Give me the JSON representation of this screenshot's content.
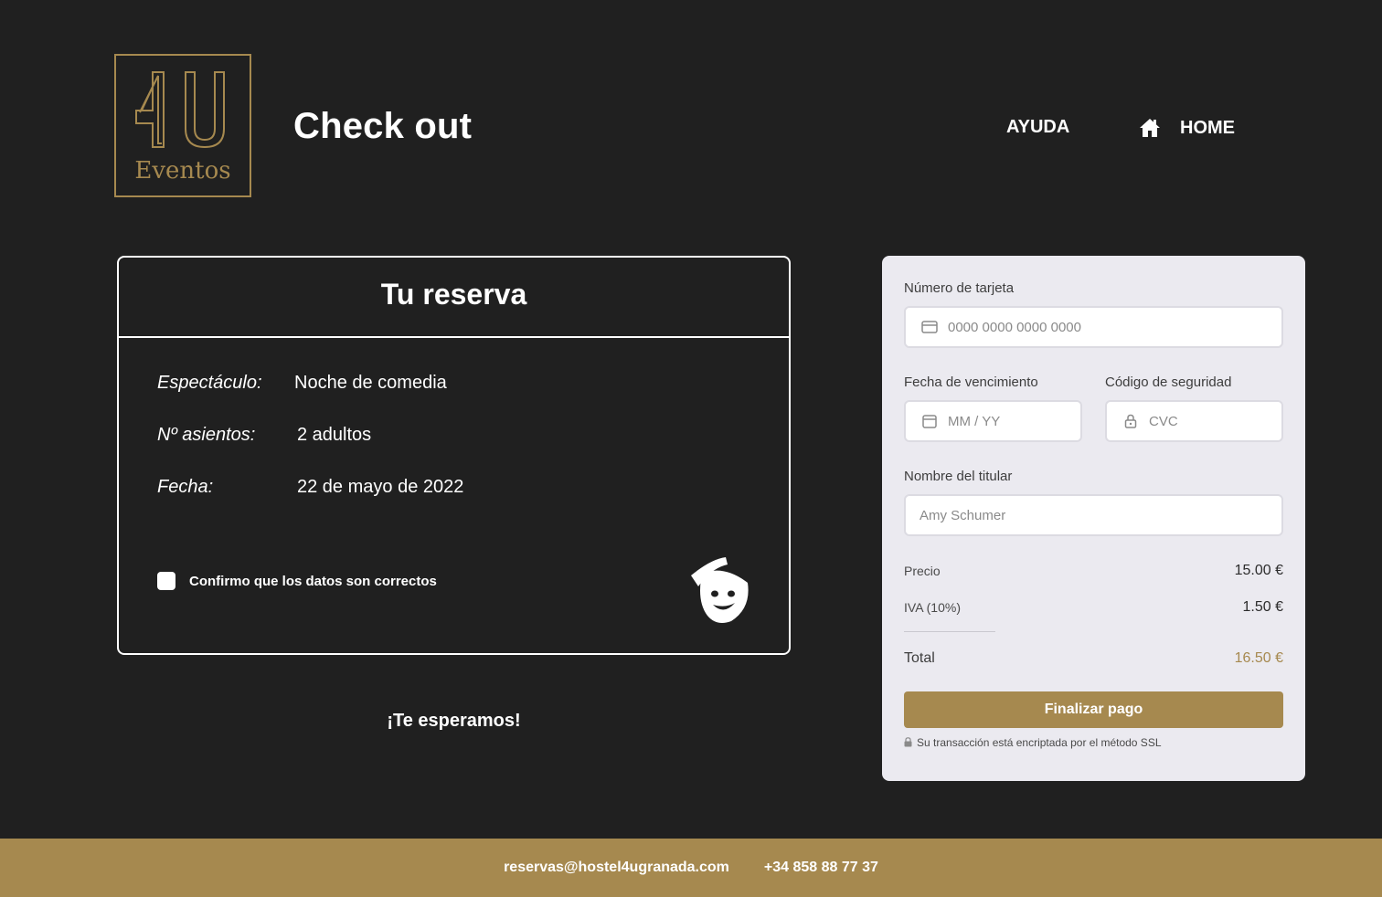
{
  "brand": {
    "logo_text": "4U",
    "logo_subtext": "Eventos",
    "accent_color": "#a6894f",
    "background_color": "#202020"
  },
  "header": {
    "title": "Check out",
    "nav": {
      "help_label": "AYUDA",
      "home_label": "HOME",
      "home_icon": "home-icon"
    }
  },
  "reservation": {
    "title": "Tu reserva",
    "rows": [
      {
        "label": "Espectáculo:",
        "value": "Noche de comedia"
      },
      {
        "label": "Nº asientos:",
        "value": "2 adultos"
      },
      {
        "label": "Fecha:",
        "value": "22 de mayo de 2022"
      }
    ],
    "confirm_label": "Confirmo que los datos son correctos",
    "confirm_checked": false,
    "decor_icon": "theater-mask-icon"
  },
  "welcome_text": "¡Te esperamos!",
  "payment": {
    "card_number": {
      "label": "Número de tarjeta",
      "placeholder": "0000 0000 0000 0000",
      "icon": "credit-card-icon"
    },
    "expiry": {
      "label": "Fecha de vencimiento",
      "placeholder": "MM / YY",
      "icon": "calendar-icon"
    },
    "cvc": {
      "label": "Código de seguridad",
      "placeholder": "CVC",
      "icon": "lock-icon"
    },
    "holder": {
      "label": "Nombre del titular",
      "placeholder": "Amy Schumer"
    },
    "summary": {
      "price_label": "Precio",
      "price_value": "15.00 €",
      "tax_label": "IVA (10%)",
      "tax_value": "1.50 €",
      "total_label": "Total",
      "total_value": "16.50 €"
    },
    "submit_label": "Finalizar pago",
    "ssl_note": "Su transacción está encriptada por el método SSL"
  },
  "footer": {
    "email": "reservas@hostel4ugranada.com",
    "phone": "+34 858 88 77 37"
  }
}
